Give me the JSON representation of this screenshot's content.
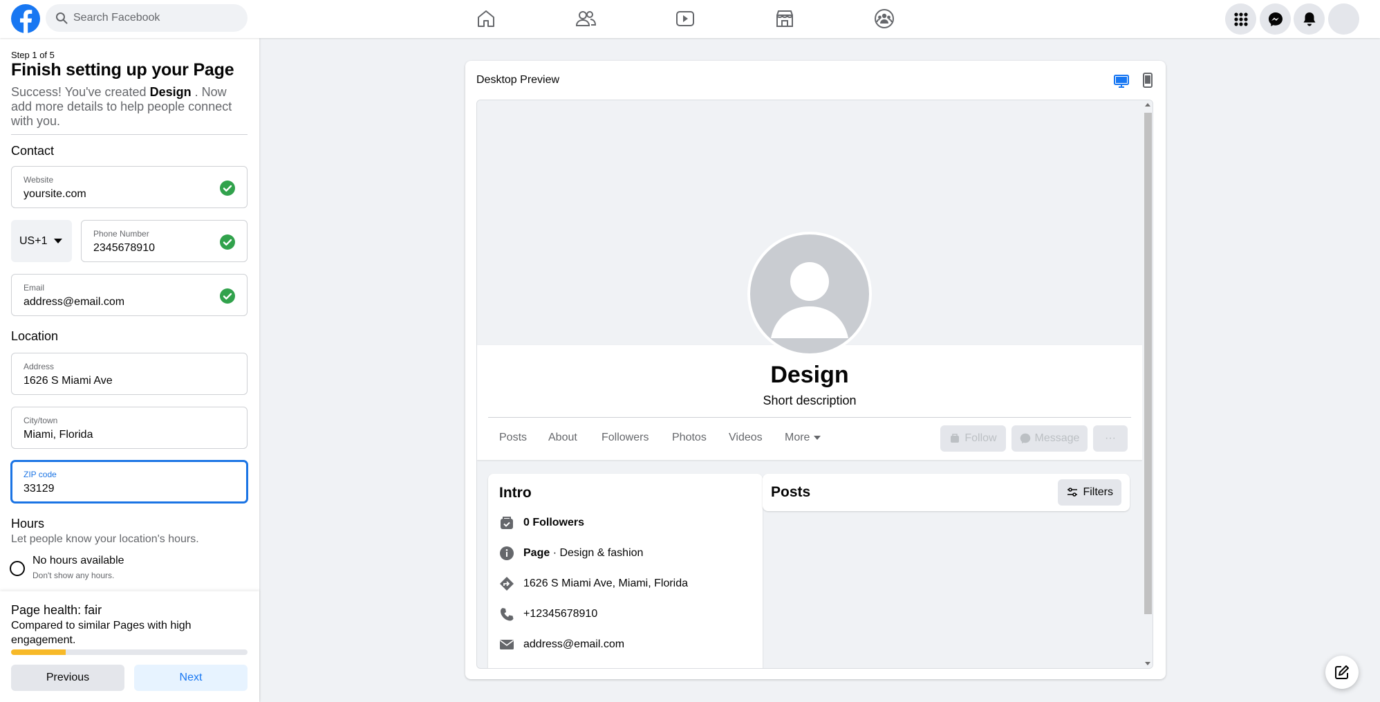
{
  "topbar": {
    "search_placeholder": "Search Facebook",
    "nav": [
      "home-icon",
      "friends-icon",
      "watch-icon",
      "marketplace-icon",
      "groups-icon"
    ],
    "right": [
      "menu-icon",
      "messenger-icon",
      "notifications-icon",
      "account-icon"
    ]
  },
  "setup": {
    "step": "Step 1 of 5",
    "title": "Finish setting up your Page",
    "intro_prefix": "Success! You've created",
    "page_name": "Design",
    "intro_suffix": ". Now add more details to help people connect with you.",
    "contact_heading": "Contact",
    "website_label": "Website",
    "website_value": "yoursite.com",
    "country_code": "US+1",
    "phone_label": "Phone Number",
    "phone_value": "2345678910",
    "email_label": "Email",
    "email_value": "address@email.com",
    "location_heading": "Location",
    "address_label": "Address",
    "address_value": "1626 S Miami Ave",
    "city_label": "City/town",
    "city_value": "Miami, Florida",
    "zip_label": "ZIP code",
    "zip_value": "33129",
    "hours_heading": "Hours",
    "hours_sub": "Let people know your location's hours.",
    "no_hours_label": "No hours available",
    "no_hours_sub": "Don't show any hours."
  },
  "health": {
    "title": "Page health: fair",
    "subtitle": "Compared to similar Pages with high engagement.",
    "progress": 0.23,
    "previous_label": "Previous",
    "next_label": "Next"
  },
  "preview": {
    "title": "Desktop Preview",
    "page_name": "Design",
    "page_desc": "Short description",
    "tabs": [
      "Posts",
      "About",
      "Followers",
      "Photos",
      "Videos",
      "More"
    ],
    "follow_label": "Follow",
    "message_label": "Message",
    "more_label": "···",
    "intro_title": "Intro",
    "followers": "0 Followers",
    "category_bold": "Page",
    "category_rest": " · Design & fashion",
    "address": "1626 S Miami Ave, Miami, Florida",
    "phone": "+12345678910",
    "email": "address@email.com",
    "posts_title": "Posts",
    "filters_label": "Filters"
  },
  "colors": {
    "brand": "#1877f2",
    "focus": "#1b74e4",
    "success": "#31a24c",
    "health_bar": "#f7b928"
  }
}
